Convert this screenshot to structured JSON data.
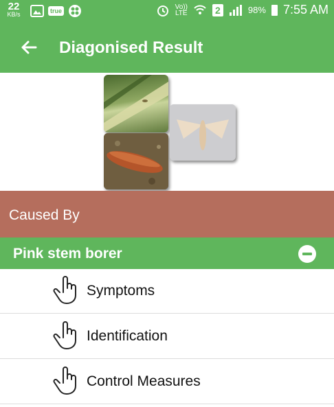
{
  "status_bar": {
    "speed_value": "22",
    "speed_unit": "KB/s",
    "true_badge": "true",
    "volte": "Vo))",
    "lte": "LTE",
    "sim": "2",
    "battery_percent": "98%",
    "time": "7:55 AM"
  },
  "app_bar": {
    "title": "Diagonised Result",
    "back_icon": "arrow-left-icon"
  },
  "caused_by": {
    "label": "Caused By"
  },
  "pest": {
    "name": "Pink stem borer",
    "toggle_icon": "minus-circle-icon"
  },
  "items": [
    {
      "label": "Symptoms",
      "icon": "pointing-hand-icon"
    },
    {
      "label": "Identification",
      "icon": "pointing-hand-icon"
    },
    {
      "label": "Control Measures",
      "icon": "pointing-hand-icon"
    }
  ],
  "colors": {
    "primary": "#5fb65c",
    "caused_by_bg": "#b56e5d"
  }
}
